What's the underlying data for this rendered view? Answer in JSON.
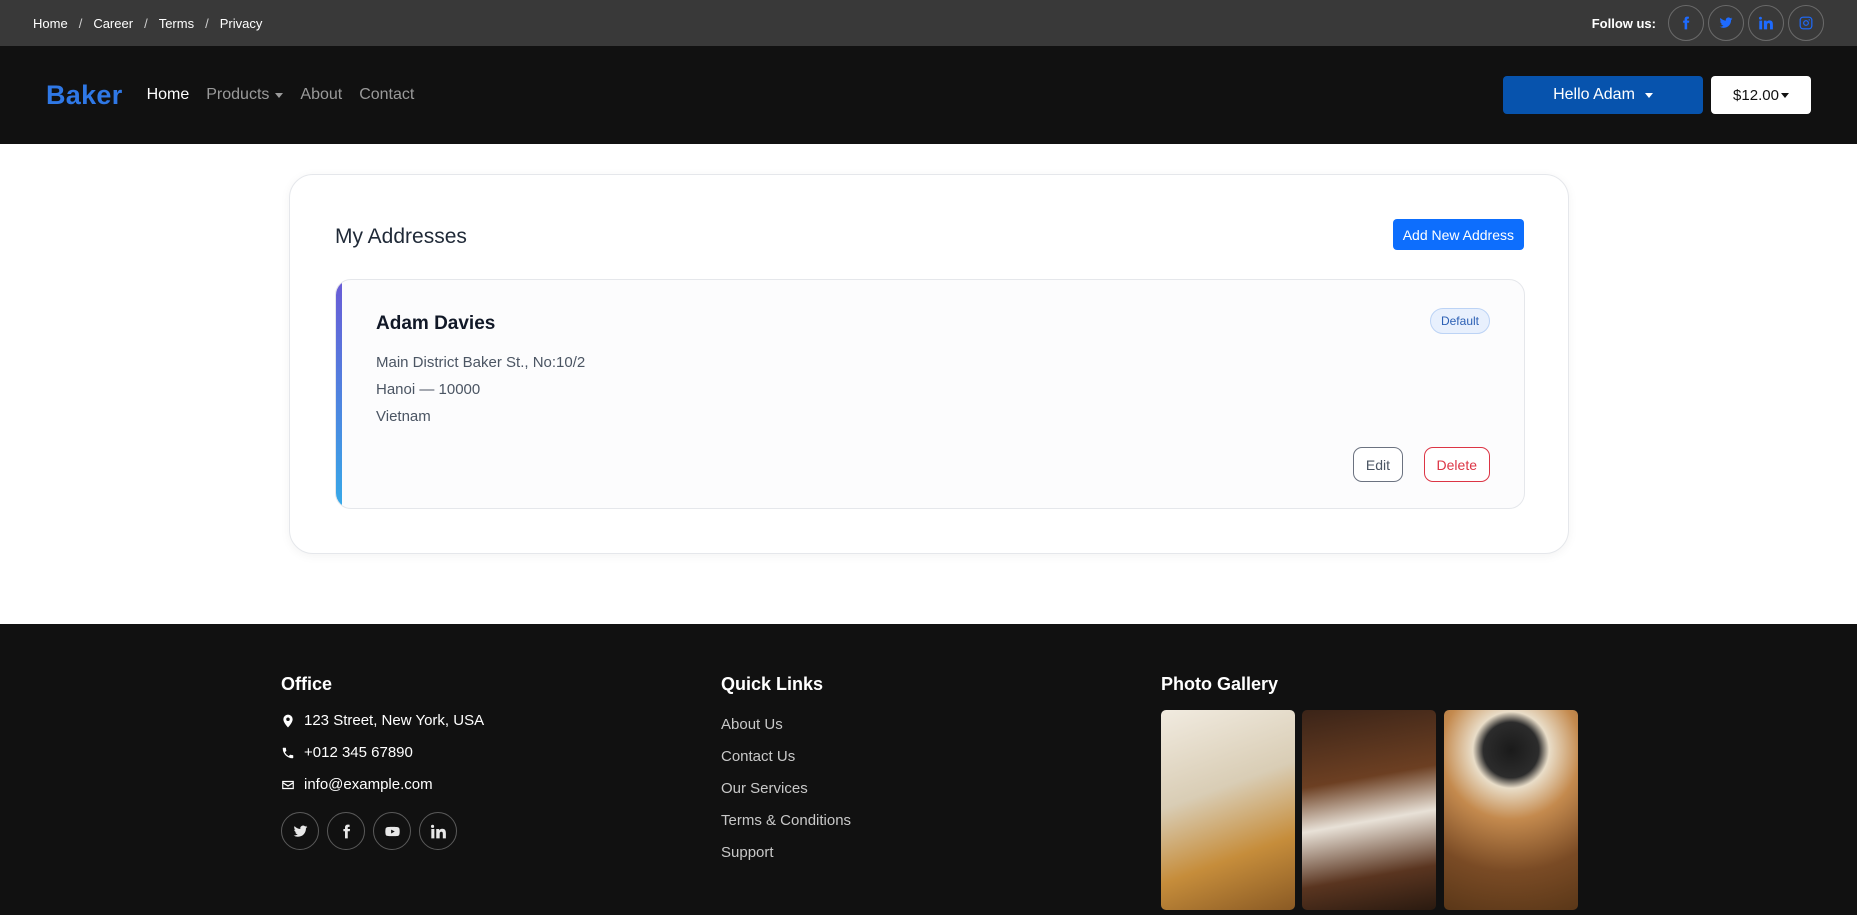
{
  "topbar": {
    "breadcrumbs": [
      "Home",
      "Career",
      "Terms",
      "Privacy"
    ],
    "separator": "/",
    "follow_label": "Follow us:",
    "social_icons": [
      "facebook-icon",
      "twitter-icon",
      "linkedin-icon",
      "instagram-icon"
    ]
  },
  "nav": {
    "brand": "Baker",
    "links": [
      "Home",
      "Products",
      "About",
      "Contact"
    ],
    "active": "Home",
    "user_button": "Hello Adam",
    "cart_button": "$12.00",
    "accent_color": "#2f78e6"
  },
  "addresses": {
    "title": "My Addresses",
    "add_button": "Add New Address",
    "items": [
      {
        "name": "Adam Davies",
        "badge": "Default",
        "line1": "Main District Baker St., No:10/2",
        "line2": "Hanoi — 10000",
        "line3": "Vietnam",
        "edit_label": "Edit",
        "delete_label": "Delete"
      }
    ]
  },
  "footer": {
    "office": {
      "heading": "Office",
      "address": "123 Street, New York, USA",
      "phone": "+012 345 67890",
      "email": "info@example.com",
      "social_icons": [
        "twitter-icon",
        "facebook-icon",
        "youtube-icon",
        "linkedin-icon"
      ]
    },
    "quick_links": {
      "heading": "Quick Links",
      "items": [
        "About Us",
        "Contact Us",
        "Our Services",
        "Terms & Conditions",
        "Support"
      ]
    },
    "gallery": {
      "heading": "Photo Gallery",
      "photos": [
        "waffle-photo",
        "cookies-plate-photo",
        "chocolate-cookies-photo"
      ]
    }
  }
}
